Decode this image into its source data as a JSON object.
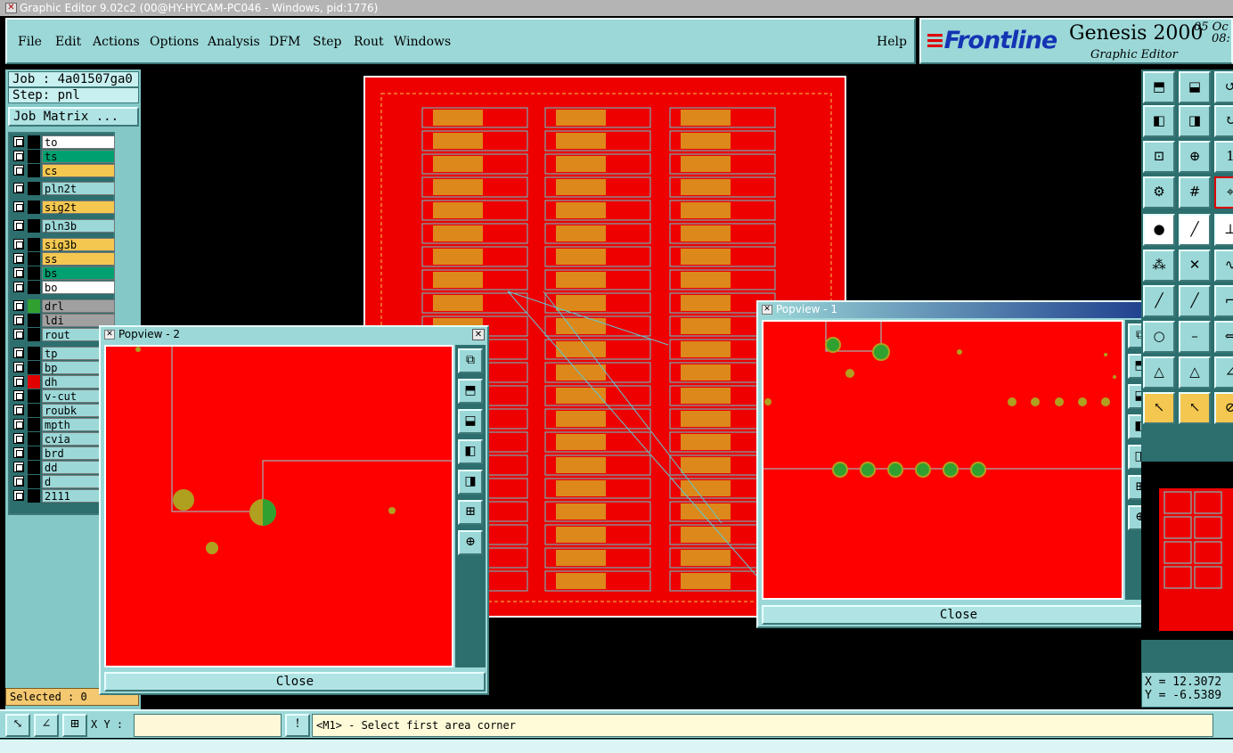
{
  "window": {
    "title": "Graphic Editor 9.02c2 (00@HY-HYCAM-PC046 - Windows, pid:1776)"
  },
  "menu": {
    "file": "File",
    "edit": "Edit",
    "actions": "Actions",
    "options": "Options",
    "analysis": "Analysis",
    "dfm": "DFM",
    "step": "Step",
    "rout": "Rout",
    "windows": "Windows",
    "help": "Help"
  },
  "brand": {
    "logo": "Frontline",
    "product": "Genesis 2000",
    "subtitle": "Graphic Editor",
    "date_top": "05 Oc",
    "time": "08:"
  },
  "job": {
    "job_label": "Job : 4a01507ga0",
    "step_label": "Step: pnl",
    "matrix_button": "Job Matrix ..."
  },
  "layers": [
    {
      "name": "to",
      "color": "#ffffff",
      "swatch": "#000000"
    },
    {
      "name": "ts",
      "color": "#00a070",
      "swatch": "#000000"
    },
    {
      "name": "cs",
      "color": "#f4c850",
      "swatch": "#000000"
    },
    {
      "name": "pln2t",
      "color": "#9cd8d8",
      "swatch": "#000000"
    },
    {
      "name": "sig2t",
      "color": "#f4c850",
      "swatch": "#000000"
    },
    {
      "name": "pln3b",
      "color": "#9cd8d8",
      "swatch": "#000000"
    },
    {
      "name": "sig3b",
      "color": "#f4c850",
      "swatch": "#000000"
    },
    {
      "name": "ss",
      "color": "#f4c850",
      "swatch": "#000000"
    },
    {
      "name": "bs",
      "color": "#00a070",
      "swatch": "#000000"
    },
    {
      "name": "bo",
      "color": "#ffffff",
      "swatch": "#000000"
    },
    {
      "name": "drl",
      "color": "#a0a0a0",
      "swatch": "#30a030"
    },
    {
      "name": "ldi",
      "color": "#a0a0a0",
      "swatch": "#000000"
    },
    {
      "name": "rout",
      "color": "#9cd8d8",
      "swatch": "#000000"
    },
    {
      "name": "tp",
      "color": "#9cd8d8",
      "swatch": "#000000"
    },
    {
      "name": "bp",
      "color": "#9cd8d8",
      "swatch": "#000000"
    },
    {
      "name": "dh",
      "color": "#9cd8d8",
      "swatch": "#e00000"
    },
    {
      "name": "v-cut",
      "color": "#9cd8d8",
      "swatch": "#000000"
    },
    {
      "name": "roubk",
      "color": "#9cd8d8",
      "swatch": "#000000"
    },
    {
      "name": "mpth",
      "color": "#9cd8d8",
      "swatch": "#000000"
    },
    {
      "name": "cvia",
      "color": "#9cd8d8",
      "swatch": "#000000"
    },
    {
      "name": "brd",
      "color": "#9cd8d8",
      "swatch": "#000000"
    },
    {
      "name": "dd",
      "color": "#9cd8d8",
      "swatch": "#000000"
    },
    {
      "name": "d",
      "color": "#9cd8d8",
      "swatch": "#000000"
    },
    {
      "name": "2111",
      "color": "#9cd8d8",
      "swatch": "#000000"
    }
  ],
  "selected": "Selected : 0",
  "popview1": {
    "title": "Popview - 1",
    "close": "Close"
  },
  "popview2": {
    "title": "Popview - 2",
    "close": "Close"
  },
  "coords": {
    "x": "X = 12.3072",
    "y": "Y = -6.5389"
  },
  "status": {
    "xy_label": "X Y :",
    "xy_value": "",
    "prompt": "<M1> - Select first area corner"
  }
}
